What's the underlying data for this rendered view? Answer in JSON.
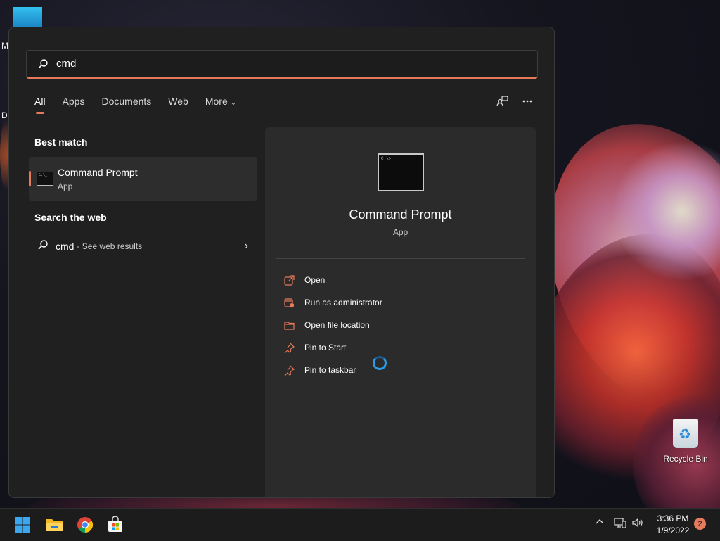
{
  "desktop": {
    "left_labels": [
      "M",
      "D"
    ],
    "recycle_bin_label": "Recycle Bin"
  },
  "search": {
    "query": "cmd"
  },
  "tabs": [
    {
      "label": "All",
      "active": true
    },
    {
      "label": "Apps",
      "active": false
    },
    {
      "label": "Documents",
      "active": false
    },
    {
      "label": "Web",
      "active": false
    },
    {
      "label": "More",
      "active": false
    }
  ],
  "header_icons": [
    "account-switch-icon",
    "more-options-icon"
  ],
  "sections": {
    "best_match": "Best match",
    "search_web": "Search the web"
  },
  "best_match_item": {
    "title": "Command Prompt",
    "subtitle": "App",
    "icon": "command-prompt-icon"
  },
  "web_result": {
    "query": "cmd",
    "suffix": "- See web results"
  },
  "details": {
    "title": "Command Prompt",
    "subtitle": "App",
    "actions": [
      {
        "label": "Open",
        "icon": "open-icon"
      },
      {
        "label": "Run as administrator",
        "icon": "run-as-admin-icon"
      },
      {
        "label": "Open file location",
        "icon": "folder-icon"
      },
      {
        "label": "Pin to Start",
        "icon": "pin-icon"
      },
      {
        "label": "Pin to taskbar",
        "icon": "pin-icon"
      }
    ]
  },
  "taskbar": {
    "apps": [
      "start-icon",
      "file-explorer-icon",
      "chrome-icon",
      "store-icon"
    ],
    "time": "3:36 PM",
    "date": "1/9/2022",
    "notifications": "2"
  },
  "colors": {
    "accent": "#e77a5a",
    "panel": "#202020",
    "detail_pane": "#2b2b2b",
    "spinner": "#2a9be6"
  }
}
